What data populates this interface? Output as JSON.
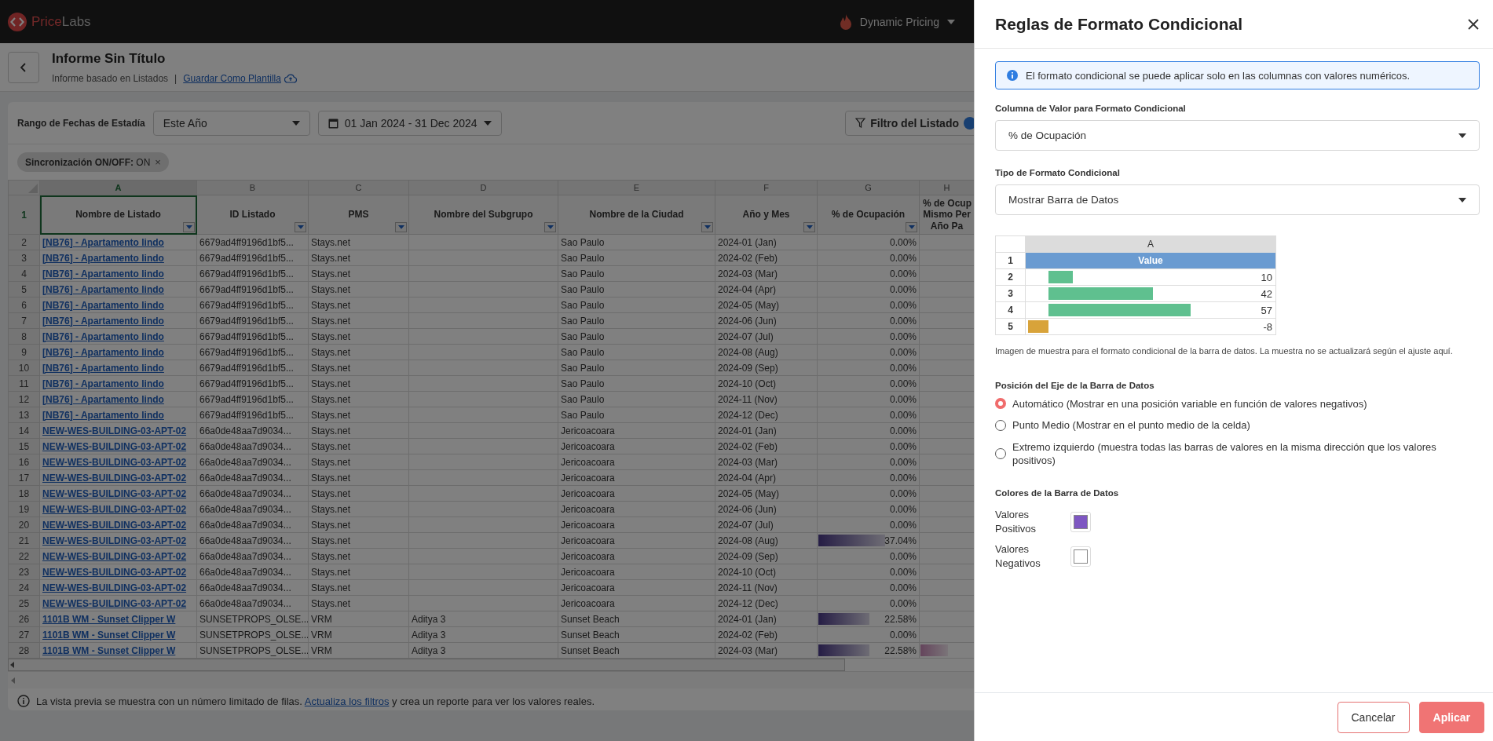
{
  "top_bar": {
    "logo": {
      "part_a": "Price",
      "part_b": "Labs"
    },
    "product_menu": {
      "label": "Dynamic Pricing"
    }
  },
  "page_header": {
    "title": "Informe Sin Título",
    "subtitle": "Informe basado en Listados",
    "separator": "|",
    "save_link": "Guardar Como Plantilla"
  },
  "filters": {
    "date_range_label": "Rango de Fechas de Estadía",
    "date_range_select": "Este Año",
    "date_picker": "01 Jan 2024 - 31 Dec 2024",
    "listing_filter_button": "Filtro del Listado"
  },
  "chips": [
    {
      "label": "Sincronización ON/OFF:",
      "value": "ON",
      "remove": "×"
    }
  ],
  "grid": {
    "corner_row_label": "1",
    "columns": [
      {
        "letter": "A",
        "header": "Nombre de Listado",
        "selected": true,
        "kind": "link"
      },
      {
        "letter": "B",
        "header": "ID Listado",
        "selected": false,
        "kind": "text"
      },
      {
        "letter": "C",
        "header": "PMS",
        "selected": false,
        "kind": "text"
      },
      {
        "letter": "D",
        "header": "Nombre del Subgrupo",
        "selected": false,
        "kind": "text"
      },
      {
        "letter": "E",
        "header": "Nombre de la Ciudad",
        "selected": false,
        "kind": "text"
      },
      {
        "letter": "F",
        "header": "Año y Mes",
        "selected": false,
        "kind": "text"
      },
      {
        "letter": "G",
        "header": "% de Ocupación",
        "selected": false,
        "kind": "bar"
      },
      {
        "letter": "H",
        "header_lines": [
          "% de Ocup",
          "Mismo Per",
          "Año Pa"
        ],
        "selected": false,
        "kind": "bar"
      }
    ],
    "rows": [
      {
        "num": "2",
        "cells": [
          "[NB76] - Apartamento lindo",
          "6679ad4ff9196d1bf5...",
          "Stays.net",
          null,
          "Sao Paulo",
          "2024-01 (Jan)",
          "0.00%",
          null
        ]
      },
      {
        "num": "3",
        "cells": [
          "[NB76] - Apartamento lindo",
          "6679ad4ff9196d1bf5...",
          "Stays.net",
          null,
          "Sao Paulo",
          "2024-02 (Feb)",
          "0.00%",
          null
        ]
      },
      {
        "num": "4",
        "cells": [
          "[NB76] - Apartamento lindo",
          "6679ad4ff9196d1bf5...",
          "Stays.net",
          null,
          "Sao Paulo",
          "2024-03 (Mar)",
          "0.00%",
          null
        ]
      },
      {
        "num": "5",
        "cells": [
          "[NB76] - Apartamento lindo",
          "6679ad4ff9196d1bf5...",
          "Stays.net",
          null,
          "Sao Paulo",
          "2024-04 (Apr)",
          "0.00%",
          null
        ]
      },
      {
        "num": "6",
        "cells": [
          "[NB76] - Apartamento lindo",
          "6679ad4ff9196d1bf5...",
          "Stays.net",
          null,
          "Sao Paulo",
          "2024-05 (May)",
          "0.00%",
          null
        ]
      },
      {
        "num": "7",
        "cells": [
          "[NB76] - Apartamento lindo",
          "6679ad4ff9196d1bf5...",
          "Stays.net",
          null,
          "Sao Paulo",
          "2024-06 (Jun)",
          "0.00%",
          null
        ]
      },
      {
        "num": "8",
        "cells": [
          "[NB76] - Apartamento lindo",
          "6679ad4ff9196d1bf5...",
          "Stays.net",
          null,
          "Sao Paulo",
          "2024-07 (Jul)",
          "0.00%",
          null
        ]
      },
      {
        "num": "9",
        "cells": [
          "[NB76] - Apartamento lindo",
          "6679ad4ff9196d1bf5...",
          "Stays.net",
          null,
          "Sao Paulo",
          "2024-08 (Aug)",
          "0.00%",
          null
        ]
      },
      {
        "num": "10",
        "cells": [
          "[NB76] - Apartamento lindo",
          "6679ad4ff9196d1bf5...",
          "Stays.net",
          null,
          "Sao Paulo",
          "2024-09 (Sep)",
          "0.00%",
          null
        ]
      },
      {
        "num": "11",
        "cells": [
          "[NB76] - Apartamento lindo",
          "6679ad4ff9196d1bf5...",
          "Stays.net",
          null,
          "Sao Paulo",
          "2024-10 (Oct)",
          "0.00%",
          null
        ]
      },
      {
        "num": "12",
        "cells": [
          "[NB76] - Apartamento lindo",
          "6679ad4ff9196d1bf5...",
          "Stays.net",
          null,
          "Sao Paulo",
          "2024-11 (Nov)",
          "0.00%",
          null
        ]
      },
      {
        "num": "13",
        "cells": [
          "[NB76] - Apartamento lindo",
          "6679ad4ff9196d1bf5...",
          "Stays.net",
          null,
          "Sao Paulo",
          "2024-12 (Dec)",
          "0.00%",
          null
        ]
      },
      {
        "num": "14",
        "cells": [
          "NEW-WES-BUILDING-03-APT-02",
          "66a0de48aa7d9034...",
          "Stays.net",
          null,
          "Jericoacoara",
          "2024-01 (Jan)",
          "0.00%",
          null
        ]
      },
      {
        "num": "15",
        "cells": [
          "NEW-WES-BUILDING-03-APT-02",
          "66a0de48aa7d9034...",
          "Stays.net",
          null,
          "Jericoacoara",
          "2024-02 (Feb)",
          "0.00%",
          null
        ]
      },
      {
        "num": "16",
        "cells": [
          "NEW-WES-BUILDING-03-APT-02",
          "66a0de48aa7d9034...",
          "Stays.net",
          null,
          "Jericoacoara",
          "2024-03 (Mar)",
          "0.00%",
          null
        ]
      },
      {
        "num": "17",
        "cells": [
          "NEW-WES-BUILDING-03-APT-02",
          "66a0de48aa7d9034...",
          "Stays.net",
          null,
          "Jericoacoara",
          "2024-04 (Apr)",
          "0.00%",
          null
        ]
      },
      {
        "num": "18",
        "cells": [
          "NEW-WES-BUILDING-03-APT-02",
          "66a0de48aa7d9034...",
          "Stays.net",
          null,
          "Jericoacoara",
          "2024-05 (May)",
          "0.00%",
          null
        ]
      },
      {
        "num": "19",
        "cells": [
          "NEW-WES-BUILDING-03-APT-02",
          "66a0de48aa7d9034...",
          "Stays.net",
          null,
          "Jericoacoara",
          "2024-06 (Jun)",
          "0.00%",
          null
        ]
      },
      {
        "num": "20",
        "cells": [
          "NEW-WES-BUILDING-03-APT-02",
          "66a0de48aa7d9034...",
          "Stays.net",
          null,
          "Jericoacoara",
          "2024-07 (Jul)",
          "0.00%",
          null
        ]
      },
      {
        "num": "21",
        "cells": [
          "NEW-WES-BUILDING-03-APT-02",
          "66a0de48aa7d9034...",
          "Stays.net",
          null,
          "Jericoacoara",
          "2024-08 (Aug)",
          {
            "text": "37.04%",
            "level": 0.66
          },
          null
        ]
      },
      {
        "num": "22",
        "cells": [
          "NEW-WES-BUILDING-03-APT-02",
          "66a0de48aa7d9034...",
          "Stays.net",
          null,
          "Jericoacoara",
          "2024-09 (Sep)",
          "0.00%",
          null
        ]
      },
      {
        "num": "23",
        "cells": [
          "NEW-WES-BUILDING-03-APT-02",
          "66a0de48aa7d9034...",
          "Stays.net",
          null,
          "Jericoacoara",
          "2024-10 (Oct)",
          "0.00%",
          null
        ]
      },
      {
        "num": "24",
        "cells": [
          "NEW-WES-BUILDING-03-APT-02",
          "66a0de48aa7d9034...",
          "Stays.net",
          null,
          "Jericoacoara",
          "2024-11 (Nov)",
          "0.00%",
          null
        ]
      },
      {
        "num": "25",
        "cells": [
          "NEW-WES-BUILDING-03-APT-02",
          "66a0de48aa7d9034...",
          "Stays.net",
          null,
          "Jericoacoara",
          "2024-12 (Dec)",
          "0.00%",
          null
        ]
      },
      {
        "num": "26",
        "cells": [
          "1101B WM - Sunset Clipper W",
          "SUNSETPROPS_OLSE...",
          "VRM",
          "Aditya 3",
          "Sunset Beach",
          "2024-01 (Jan)",
          {
            "text": "22.58%",
            "level": 0.5
          },
          null
        ]
      },
      {
        "num": "27",
        "cells": [
          "1101B WM - Sunset Clipper W",
          "SUNSETPROPS_OLSE...",
          "VRM",
          "Aditya 3",
          "Sunset Beach",
          "2024-02 (Feb)",
          "0.00%",
          null
        ]
      },
      {
        "num": "28",
        "cells": [
          "1101B WM - Sunset Clipper W",
          "SUNSETPROPS_OLSE...",
          "VRM",
          "Aditya 3",
          "Sunset Beach",
          "2024-03 (Mar)",
          {
            "text": "22.58%",
            "level": 0.5
          },
          {
            "level": 0.5
          }
        ]
      }
    ]
  },
  "footer_note": {
    "before": "La vista previa se muestra con un número limitado de filas.",
    "link": "Actualiza los filtros",
    "after": "y crea un reporte para ver los valores reales."
  },
  "panel": {
    "title": "Reglas de Formato Condicional",
    "info": "El formato condicional se puede aplicar solo en las columnas con valores numéricos.",
    "value_column": {
      "label": "Columna de Valor para Formato Condicional",
      "value": "% de Ocupación"
    },
    "format_type": {
      "label": "Tipo de Formato Condicional",
      "value": "Mostrar Barra de Datos"
    },
    "sample": {
      "column_letter": "A",
      "header_row": "1",
      "header": "Value",
      "rows": [
        {
          "num": "2",
          "value": "10",
          "kind": "positive"
        },
        {
          "num": "3",
          "value": "42",
          "kind": "positive"
        },
        {
          "num": "4",
          "value": "57",
          "kind": "positive"
        },
        {
          "num": "5",
          "value": "-8",
          "kind": "negative"
        }
      ]
    },
    "sample_caption": "Imagen de muestra para el formato condicional de la barra de datos. La muestra no se actualizará según el ajuste aquí.",
    "axis_label": "Posición del Eje de la Barra de Datos",
    "axis_options": [
      {
        "label": "Automático (Mostrar en una posición variable en función de valores negativos)",
        "selected": true
      },
      {
        "label": "Punto Medio (Mostrar en el punto medio de la celda)",
        "selected": false
      },
      {
        "label": "Extremo izquierdo (muestra todas las barras de valores en la misma dirección que los valores positivos)",
        "selected": false
      }
    ],
    "colors_label": "Colores de la Barra de Datos",
    "colors": [
      {
        "label": "Valores Positivos",
        "color": "#7e57c2"
      },
      {
        "label": "Valores Negativos",
        "color": "#ffffff"
      }
    ],
    "buttons": [
      {
        "label": "Cancelar",
        "kind": "secondary"
      },
      {
        "label": "Aplicar",
        "kind": "primary"
      }
    ]
  }
}
